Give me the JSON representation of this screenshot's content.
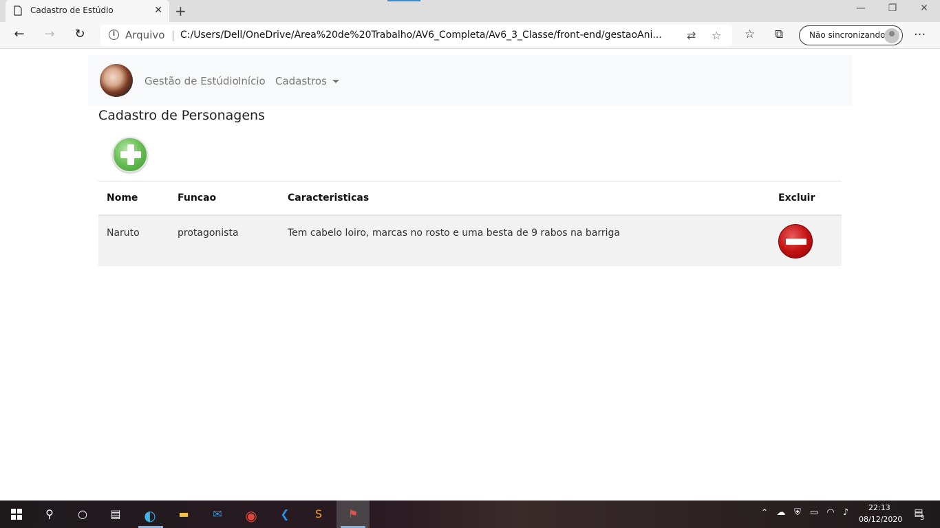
{
  "browser": {
    "tab_title": "Cadastro de Estúdio",
    "close_glyph": "✕",
    "new_tab_glyph": "+",
    "back_glyph": "←",
    "forward_glyph": "→",
    "refresh_glyph": "↻",
    "url_label": "Arquivo",
    "url_sep": "|",
    "url": "C:/Users/Dell/OneDrive/Área%20de%20Trabalho/AV6_Completa/Av6_3_Classe/front-end/gestaoAni...",
    "sync_label": "Não sincronizando",
    "more_glyph": "···",
    "min_glyph": "—",
    "restore_glyph": "❐",
    "winclose_glyph": "✕"
  },
  "navbar": {
    "brand": "Gestão de Estúdio",
    "links": [
      "Início",
      "Cadastros"
    ]
  },
  "page": {
    "title": "Cadastro de Personagens"
  },
  "table": {
    "headers": [
      "Nome",
      "Funcao",
      "Caracteristicas",
      "Excluir"
    ],
    "rows": [
      {
        "nome": "Naruto",
        "funcao": "protagonista",
        "caracteristicas": "Tem cabelo loiro, marcas no rosto e uma besta de 9 rabos na barriga"
      }
    ]
  },
  "taskbar": {
    "time": "22:13",
    "date": "08/12/2020",
    "notifications": "3"
  },
  "colors": {
    "add_green": "#4caf50",
    "delete_red": "#c41414",
    "navbar_bg": "#f8f9fa"
  }
}
